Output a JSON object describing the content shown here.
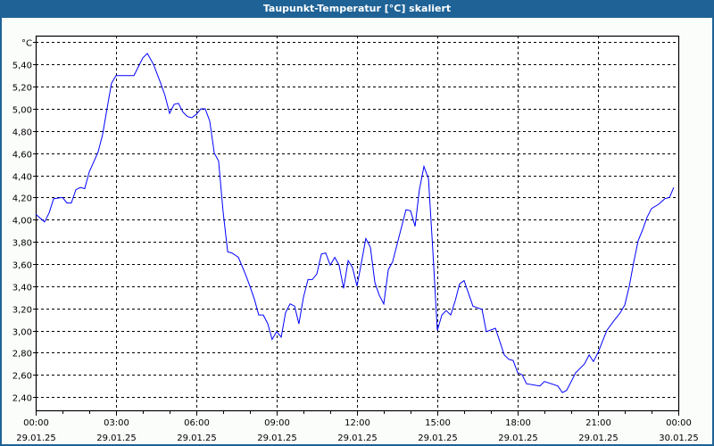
{
  "window": {
    "title": "Taupunkt-Temperatur [°C] skaliert"
  },
  "colors": {
    "titlebar": "#1f6396",
    "line": "#0000ff",
    "grid": "#000000"
  },
  "chart_data": {
    "type": "line",
    "title": "Taupunkt-Temperatur [°C] skaliert",
    "ylabel": "°C",
    "xlabel": "",
    "xunit": "hours since 29.01.25 00:00",
    "xlim": [
      0,
      24
    ],
    "ylim": [
      2.28,
      5.66
    ],
    "grid": true,
    "yticks": [
      2.4,
      2.6,
      2.8,
      3.0,
      3.2,
      3.4,
      3.6,
      3.8,
      4.0,
      4.2,
      4.4,
      4.6,
      4.8,
      5.0,
      5.2,
      5.4,
      5.6
    ],
    "ytick_labels": [
      "2,40",
      "2,60",
      "2,80",
      "3,00",
      "3,20",
      "3,40",
      "3,60",
      "3,80",
      "4,00",
      "4,20",
      "4,40",
      "4,60",
      "4,80",
      "5,00",
      "5,20",
      "5,40",
      "°C"
    ],
    "xticks": [
      {
        "t": 0,
        "time": "00:00",
        "date": "29.01.25"
      },
      {
        "t": 3,
        "time": "03:00",
        "date": "29.01.25"
      },
      {
        "t": 6,
        "time": "06:00",
        "date": "29.01.25"
      },
      {
        "t": 9,
        "time": "09:00",
        "date": "29.01.25"
      },
      {
        "t": 12,
        "time": "12:00",
        "date": "29.01.25"
      },
      {
        "t": 15,
        "time": "15:00",
        "date": "29.01.25"
      },
      {
        "t": 18,
        "time": "18:00",
        "date": "29.01.25"
      },
      {
        "t": 21,
        "time": "21:00",
        "date": "29.01.25"
      },
      {
        "t": 24,
        "time": "00:00",
        "date": "30.01.25"
      }
    ],
    "series": [
      {
        "name": "Taupunkt-Temperatur",
        "points": [
          [
            0,
            4.05
          ],
          [
            0.33,
            3.98
          ],
          [
            0.5,
            4.06
          ],
          [
            0.67,
            4.19
          ],
          [
            1,
            4.2
          ],
          [
            1.17,
            4.15
          ],
          [
            1.33,
            4.15
          ],
          [
            1.5,
            4.27
          ],
          [
            1.67,
            4.29
          ],
          [
            1.83,
            4.28
          ],
          [
            2,
            4.43
          ],
          [
            2.33,
            4.61
          ],
          [
            2.5,
            4.77
          ],
          [
            2.67,
            5.01
          ],
          [
            2.83,
            5.23
          ],
          [
            3,
            5.3
          ],
          [
            3.67,
            5.3
          ],
          [
            4,
            5.46
          ],
          [
            4.17,
            5.5
          ],
          [
            4.4,
            5.4
          ],
          [
            4.67,
            5.23
          ],
          [
            4.83,
            5.12
          ],
          [
            5,
            4.96
          ],
          [
            5.17,
            5.04
          ],
          [
            5.33,
            5.05
          ],
          [
            5.5,
            4.97
          ],
          [
            5.67,
            4.93
          ],
          [
            5.83,
            4.92
          ],
          [
            6,
            4.95
          ],
          [
            6.17,
            5.0
          ],
          [
            6.33,
            5.0
          ],
          [
            6.5,
            4.89
          ],
          [
            6.67,
            4.6
          ],
          [
            6.83,
            4.53
          ],
          [
            7,
            4.07
          ],
          [
            7.17,
            3.71
          ],
          [
            7.33,
            3.7
          ],
          [
            7.57,
            3.66
          ],
          [
            7.83,
            3.51
          ],
          [
            8,
            3.4
          ],
          [
            8.17,
            3.28
          ],
          [
            8.33,
            3.14
          ],
          [
            8.5,
            3.14
          ],
          [
            8.67,
            3.06
          ],
          [
            8.83,
            2.92
          ],
          [
            9,
            2.99
          ],
          [
            9.17,
            2.94
          ],
          [
            9.33,
            3.16
          ],
          [
            9.5,
            3.24
          ],
          [
            9.67,
            3.22
          ],
          [
            9.83,
            3.06
          ],
          [
            10,
            3.3
          ],
          [
            10.17,
            3.46
          ],
          [
            10.33,
            3.46
          ],
          [
            10.5,
            3.51
          ],
          [
            10.67,
            3.69
          ],
          [
            10.83,
            3.7
          ],
          [
            11,
            3.59
          ],
          [
            11.17,
            3.66
          ],
          [
            11.33,
            3.59
          ],
          [
            11.5,
            3.38
          ],
          [
            11.67,
            3.63
          ],
          [
            11.83,
            3.57
          ],
          [
            12,
            3.4
          ],
          [
            12.17,
            3.62
          ],
          [
            12.33,
            3.83
          ],
          [
            12.5,
            3.75
          ],
          [
            12.67,
            3.43
          ],
          [
            12.83,
            3.32
          ],
          [
            13,
            3.24
          ],
          [
            13.17,
            3.55
          ],
          [
            13.33,
            3.62
          ],
          [
            13.5,
            3.78
          ],
          [
            13.67,
            3.94
          ],
          [
            13.83,
            4.09
          ],
          [
            14,
            4.08
          ],
          [
            14.17,
            3.94
          ],
          [
            14.33,
            4.27
          ],
          [
            14.5,
            4.48
          ],
          [
            14.67,
            4.37
          ],
          [
            14.83,
            3.73
          ],
          [
            15,
            3.0
          ],
          [
            15.17,
            3.14
          ],
          [
            15.33,
            3.18
          ],
          [
            15.5,
            3.14
          ],
          [
            15.67,
            3.27
          ],
          [
            15.83,
            3.42
          ],
          [
            16,
            3.45
          ],
          [
            16.33,
            3.22
          ],
          [
            16.67,
            3.19
          ],
          [
            16.83,
            2.99
          ],
          [
            17.17,
            3.02
          ],
          [
            17.5,
            2.78
          ],
          [
            17.67,
            2.74
          ],
          [
            17.83,
            2.73
          ],
          [
            18,
            2.62
          ],
          [
            18.17,
            2.6
          ],
          [
            18.33,
            2.52
          ],
          [
            18.83,
            2.5
          ],
          [
            19,
            2.54
          ],
          [
            19.5,
            2.5
          ],
          [
            19.67,
            2.44
          ],
          [
            19.83,
            2.46
          ],
          [
            20.17,
            2.62
          ],
          [
            20.5,
            2.7
          ],
          [
            20.67,
            2.78
          ],
          [
            20.83,
            2.72
          ],
          [
            21,
            2.8
          ],
          [
            21.33,
            3.0
          ],
          [
            21.57,
            3.08
          ],
          [
            21.83,
            3.16
          ],
          [
            22,
            3.23
          ],
          [
            22.17,
            3.4
          ],
          [
            22.33,
            3.61
          ],
          [
            22.5,
            3.81
          ],
          [
            22.67,
            3.91
          ],
          [
            22.83,
            4.02
          ],
          [
            23,
            4.1
          ],
          [
            23.27,
            4.14
          ],
          [
            23.5,
            4.19
          ],
          [
            23.67,
            4.2
          ],
          [
            23.83,
            4.29
          ]
        ]
      }
    ]
  }
}
